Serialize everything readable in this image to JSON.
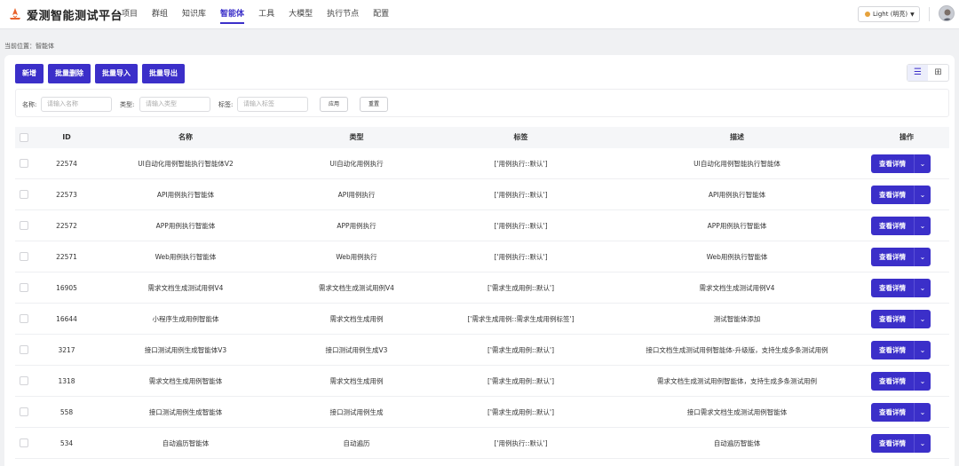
{
  "app": {
    "title": "爱测智能测试平台"
  },
  "nav": {
    "items": [
      "项目",
      "群组",
      "知识库",
      "智能体",
      "工具",
      "大模型",
      "执行节点",
      "配置"
    ],
    "active_index": 3
  },
  "header": {
    "theme_label": "Light (明亮)"
  },
  "breadcrumb": {
    "text": "当前位置：智能体"
  },
  "toolbar": {
    "add": "新增",
    "batch_delete": "批量删除",
    "batch_import": "批量导入",
    "batch_export": "批量导出"
  },
  "view_toggle": {
    "active": "list"
  },
  "filters": {
    "name_label": "名称:",
    "name_placeholder": "请输入名称",
    "type_label": "类型:",
    "type_placeholder": "请输入类型",
    "tag_label": "标签:",
    "tag_placeholder": "请输入标签",
    "apply": "应用",
    "reset": "重置"
  },
  "table": {
    "columns": [
      "ID",
      "名称",
      "类型",
      "标签",
      "描述",
      "操作"
    ],
    "action_label": "查看详情",
    "rows": [
      {
        "id": "22574",
        "name": "UI自动化用例智能执行智能体V2",
        "type": "UI自动化用例执行",
        "tag": "['用例执行::默认']",
        "desc": "UI自动化用例智能执行智能体"
      },
      {
        "id": "22573",
        "name": "API用例执行智能体",
        "type": "API用例执行",
        "tag": "['用例执行::默认']",
        "desc": "API用例执行智能体"
      },
      {
        "id": "22572",
        "name": "APP用例执行智能体",
        "type": "APP用例执行",
        "tag": "['用例执行::默认']",
        "desc": "APP用例执行智能体"
      },
      {
        "id": "22571",
        "name": "Web用例执行智能体",
        "type": "Web用例执行",
        "tag": "['用例执行::默认']",
        "desc": "Web用例执行智能体"
      },
      {
        "id": "16905",
        "name": "需求文档生成测试用例V4",
        "type": "需求文档生成测试用例V4",
        "tag": "['需求生成用例::默认']",
        "desc": "需求文档生成测试用例V4"
      },
      {
        "id": "16644",
        "name": "小程序生成用例智能体",
        "type": "需求文档生成用例",
        "tag": "['需求生成用例::需求生成用例标签']",
        "desc": "测试智能体添加"
      },
      {
        "id": "3217",
        "name": "接口测试用例生成智能体V3",
        "type": "接口测试用例生成V3",
        "tag": "['需求生成用例::默认']",
        "desc": "接口文档生成测试用例智能体-升级版，支持生成多条测试用例"
      },
      {
        "id": "1318",
        "name": "需求文档生成用例智能体",
        "type": "需求文档生成用例",
        "tag": "['需求生成用例::默认']",
        "desc": "需求文档生成测试用例智能体，支持生成多条测试用例"
      },
      {
        "id": "558",
        "name": "接口测试用例生成智能体",
        "type": "接口测试用例生成",
        "tag": "['需求生成用例::默认']",
        "desc": "接口需求文档生成测试用例智能体"
      },
      {
        "id": "534",
        "name": "自动遍历智能体",
        "type": "自动遍历",
        "tag": "['用例执行::默认']",
        "desc": "自动遍历智能体"
      }
    ]
  },
  "colors": {
    "primary": "#3b2fc9",
    "logo": "#e8622c"
  },
  "icons": [
    "logo-icon",
    "list-view-icon",
    "grid-view-icon",
    "chevron-down-icon",
    "theme-dot-icon",
    "avatar"
  ]
}
